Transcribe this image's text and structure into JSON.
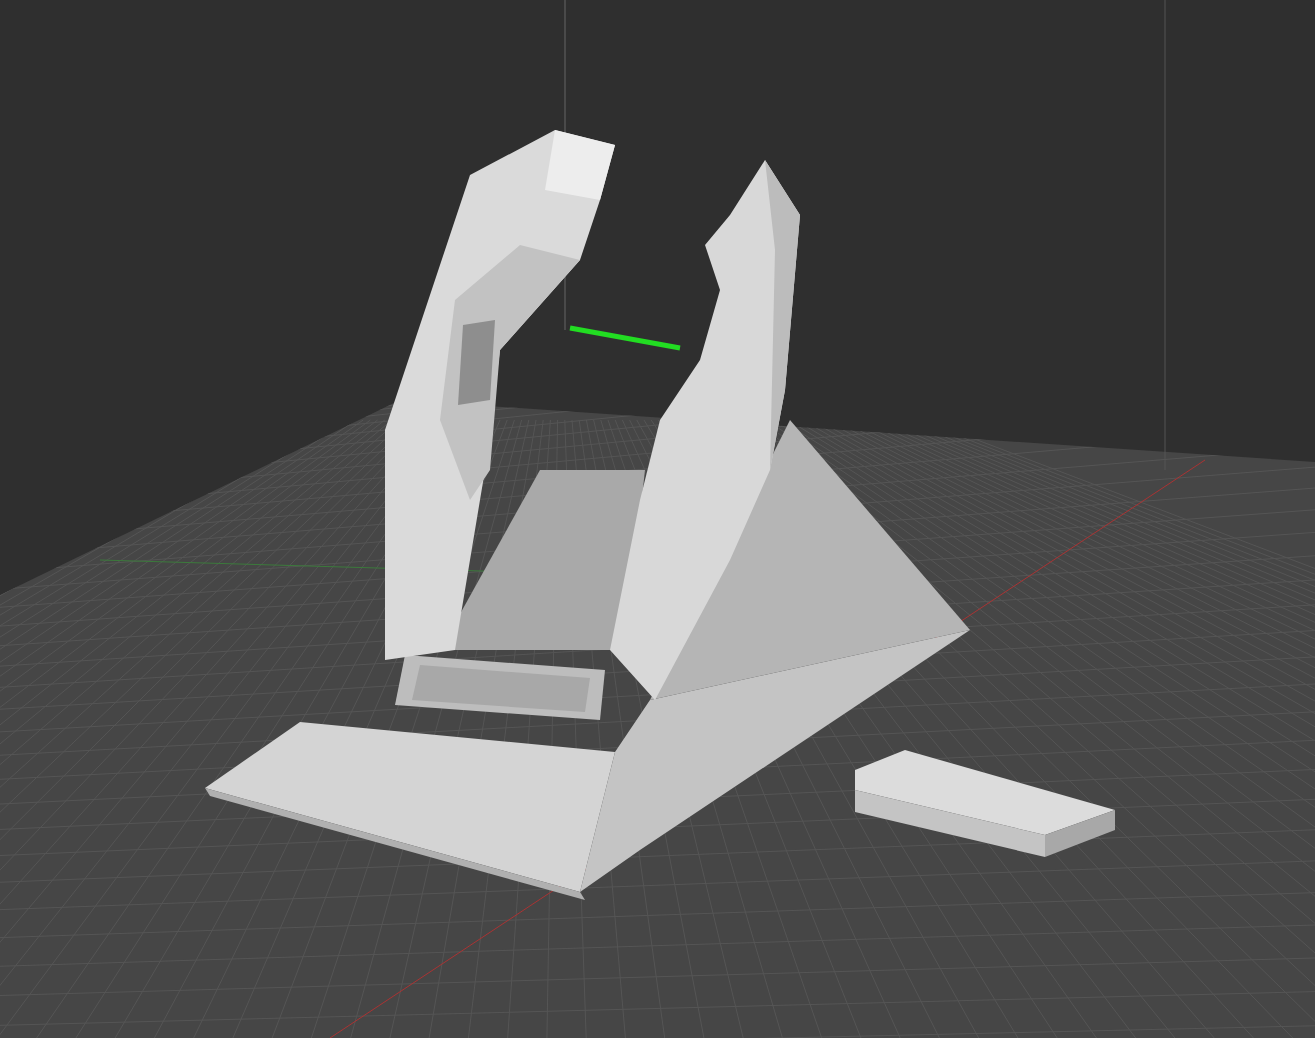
{
  "viewport": {
    "kind": "perspective",
    "show_grid": true,
    "show_axes": true
  }
}
